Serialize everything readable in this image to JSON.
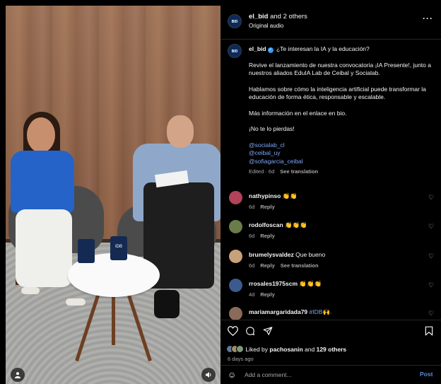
{
  "video": {
    "mug_label": "IDB",
    "controls": {
      "profile_icon": "person-icon",
      "audio_icon": "speaker-icon"
    }
  },
  "header": {
    "account": "el_bid",
    "title_suffix": "and 2 others",
    "subtitle": "Original audio",
    "avatar_text": "BID"
  },
  "caption": {
    "username": "el_bid",
    "line1": "¿Te interesan la IA y la educación?",
    "para2": "Revive el lanzamiento de nuestra convocatoria ¡IA Presente!, junto a nuestros aliados EduIA Lab de Ceibal y Socialab.",
    "para3": "Hablamos sobre cómo la inteligencia artificial puede transformar la educación de forma ética, responsable y escalable.",
    "para4": "Más información en el enlace en bio.",
    "para5": "¡No te lo pierdas!",
    "mentions": [
      "@socialab_cl",
      "@ceibal_uy",
      "@sofiagarcia_ceibal"
    ],
    "edited": "Edited · 6d",
    "see_translation": "See translation"
  },
  "comments": [
    {
      "user": "nathypinso",
      "text": "👏👏",
      "time": "6d",
      "reply": "Reply",
      "translation": ""
    },
    {
      "user": "rodolfoscan",
      "text": "👏👏👏",
      "time": "6d",
      "reply": "Reply",
      "translation": ""
    },
    {
      "user": "brumelysvaldez",
      "text": "Que bueno",
      "time": "6d",
      "reply": "Reply",
      "translation": "See translation"
    },
    {
      "user": "rrosales1975scm",
      "text": "👏👏👏",
      "time": "4d",
      "reply": "Reply",
      "translation": ""
    },
    {
      "user": "mariamargaridada79",
      "text": "#IDB🙌.",
      "time": "",
      "reply": "",
      "translation": ""
    }
  ],
  "actions": {
    "likes_prefix": "Liked by",
    "likes_user": "pachosanin",
    "likes_and": "and",
    "likes_others": "129 others",
    "ago": "6 days ago",
    "comment_placeholder": "Add a comment...",
    "post_label": "Post"
  },
  "colors": {
    "link": "#7ea6f5",
    "verified": "#3897f0",
    "post": "#5d8bd6",
    "background": "#000000"
  }
}
